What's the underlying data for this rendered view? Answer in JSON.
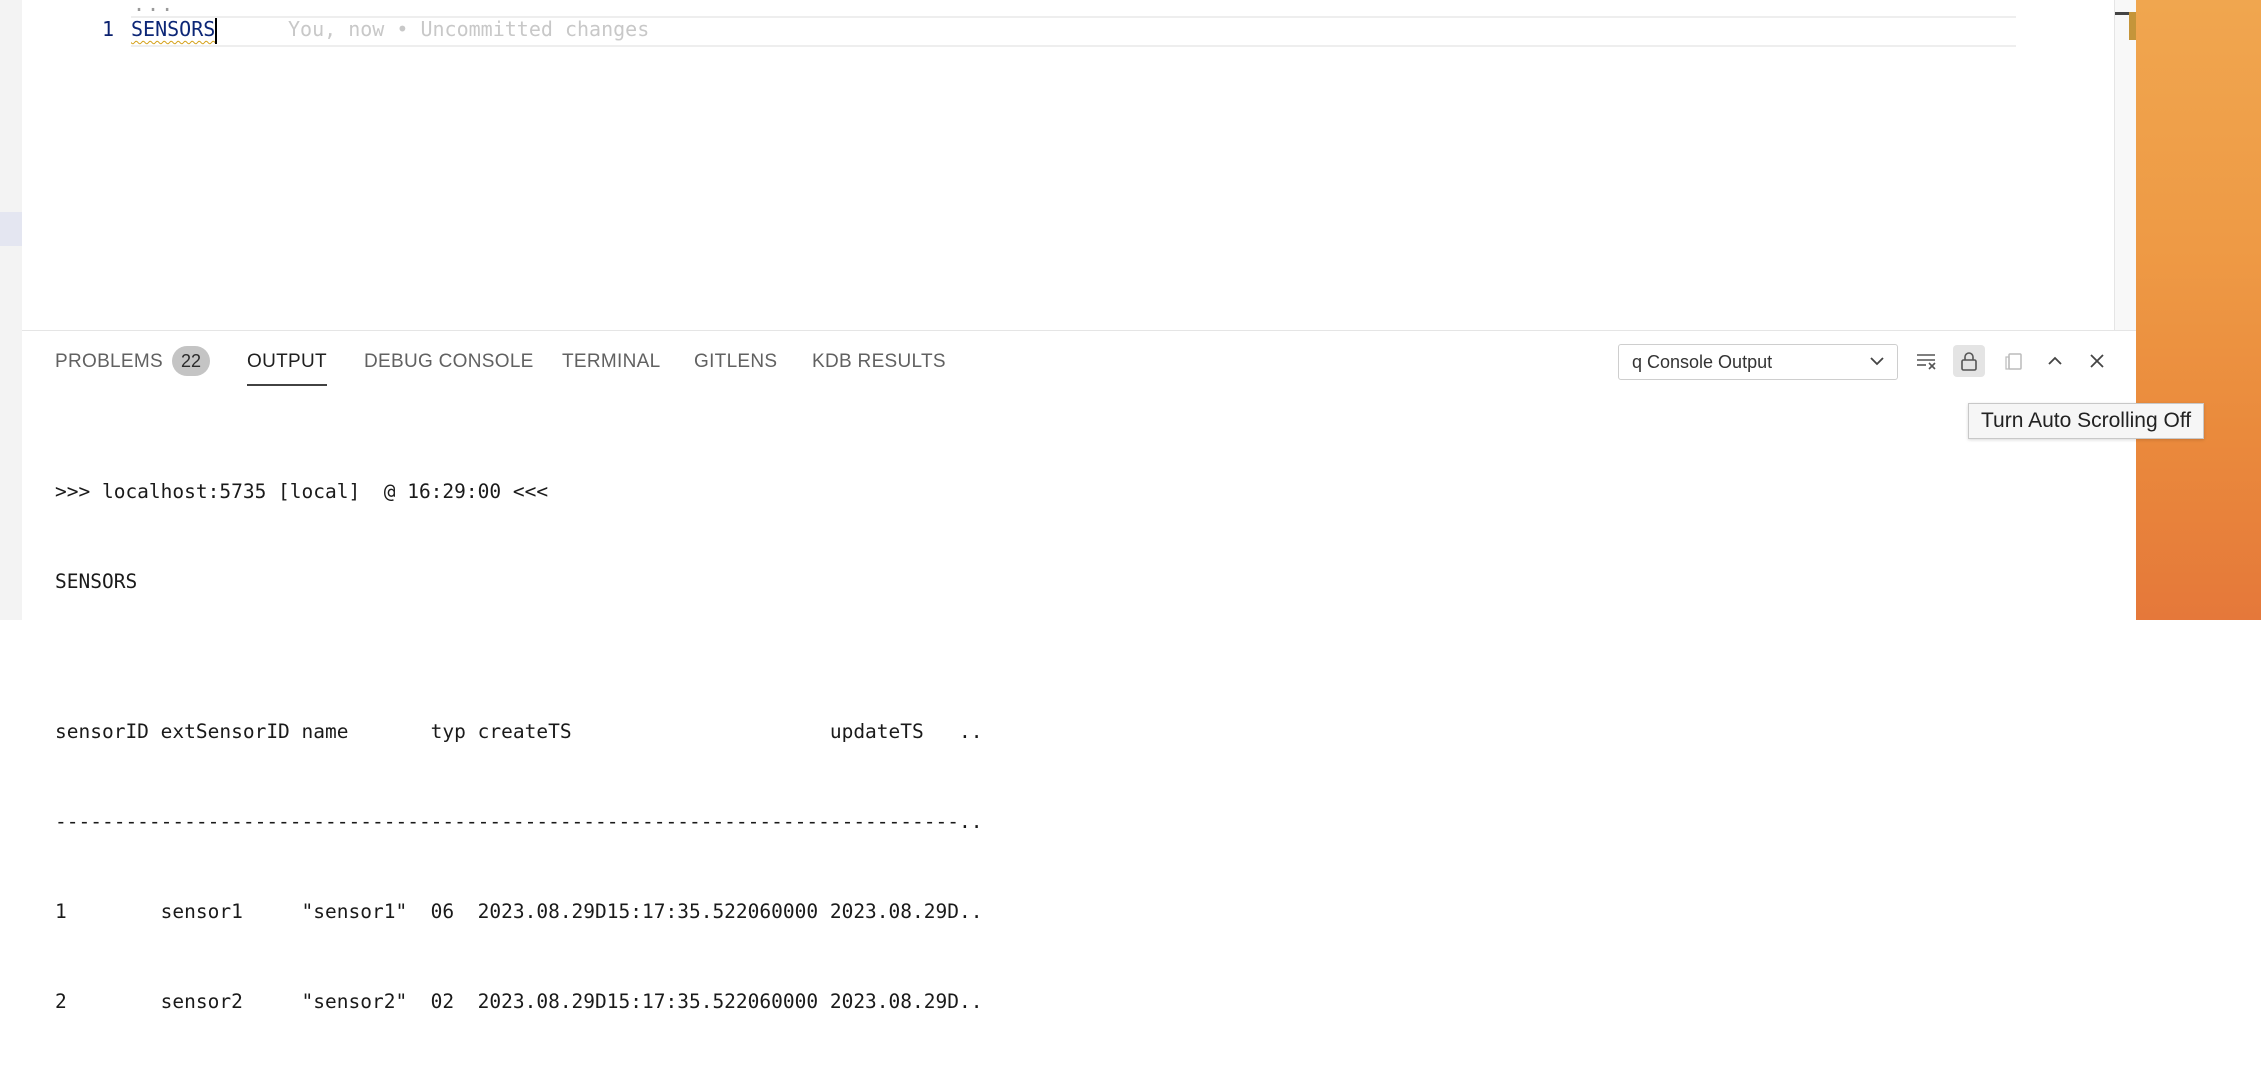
{
  "editor": {
    "line_number": "1",
    "code": "SENSORS",
    "blame_annotation": "You, now • Uncommitted changes",
    "fold_marker": "..."
  },
  "panel": {
    "tabs": [
      {
        "label": "PROBLEMS",
        "badge": "22"
      },
      {
        "label": "OUTPUT",
        "active": true
      },
      {
        "label": "DEBUG CONSOLE"
      },
      {
        "label": "TERMINAL"
      },
      {
        "label": "GITLENS"
      },
      {
        "label": "KDB RESULTS"
      }
    ],
    "channel_select": "q Console Output",
    "tools": [
      "clear-output-icon",
      "lock-icon",
      "copy-icon",
      "chevron-up-icon",
      "close-icon"
    ]
  },
  "output": {
    "lines": [
      ">>> localhost:5735 [local]  @ 16:29:00 <<<",
      "SENSORS",
      "",
      "sensorID extSensorID name       typ createTS                      updateTS   ..",
      "-----------------------------------------------------------------------------..",
      "1        sensor1     \"sensor1\"  06  2023.08.29D15:17:35.522060000 2023.08.29D..",
      "2        sensor2     \"sensor2\"  02  2023.08.29D15:17:35.522060000 2023.08.29D.."
    ]
  },
  "tooltip": {
    "text": "Turn Auto Scrolling Off"
  },
  "colors": {
    "wallpaper": "#ee9a45",
    "accent_tab_underline": "#424242"
  }
}
